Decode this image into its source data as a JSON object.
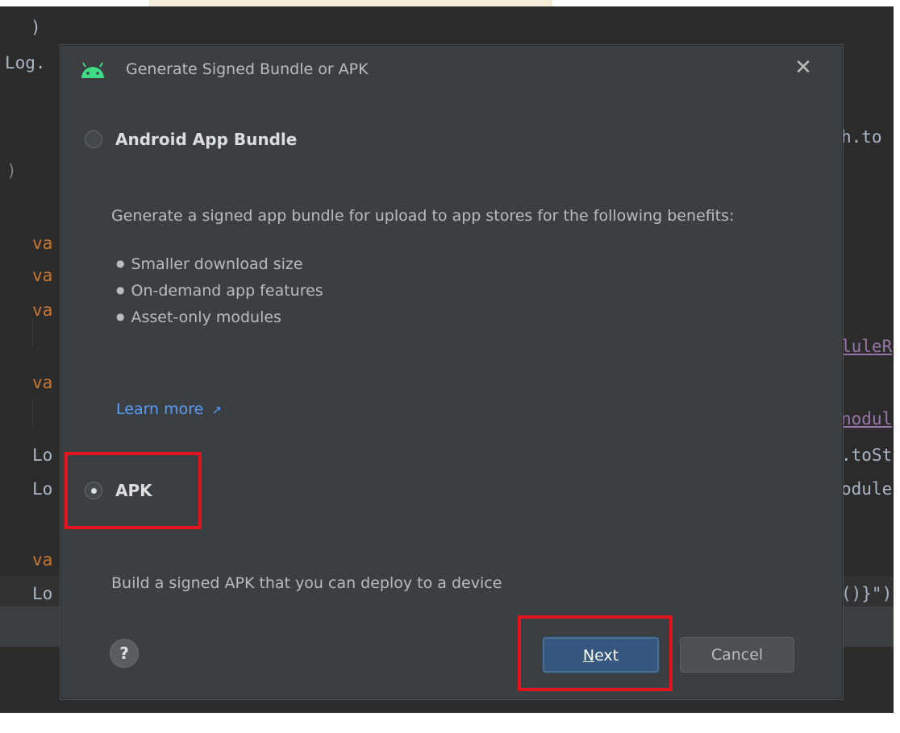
{
  "editor": {
    "lines_left": [
      {
        "text": ")",
        "kind": "plain"
      },
      {
        "text": "Log.",
        "kind": "plain"
      },
      {
        "text": ")",
        "kind": "gray"
      },
      {
        "text": "va",
        "kind": "kw"
      },
      {
        "text": "va",
        "kind": "kw"
      },
      {
        "text": "va",
        "kind": "kw"
      },
      {
        "text": "va",
        "kind": "kw"
      },
      {
        "text": "Lo",
        "kind": "plain"
      },
      {
        "text": "Lo",
        "kind": "plain"
      },
      {
        "text": "va",
        "kind": "kw"
      },
      {
        "text": "Lo",
        "kind": "plain"
      }
    ],
    "lines_right": [
      {
        "text": "h.to",
        "kind": "plain"
      },
      {
        "text": "luleR",
        "kind": "purple"
      },
      {
        "text": "nodul",
        "kind": "purple"
      },
      {
        "text": ".toSt",
        "kind": "plain"
      },
      {
        "text": "odule",
        "kind": "plain"
      },
      {
        "text": "()}\")",
        "kind": "plain"
      }
    ]
  },
  "dialog": {
    "title": "Generate Signed Bundle or APK",
    "close_glyph": "✕",
    "option_bundle": {
      "label": "Android App Bundle",
      "selected": false,
      "description": "Generate a signed app bundle for upload to app stores for the following benefits:",
      "benefits": [
        "Smaller download size",
        "On-demand app features",
        "Asset-only modules"
      ],
      "learn_more": "Learn more",
      "learn_more_arrow": "↗"
    },
    "option_apk": {
      "label": "APK",
      "selected": true,
      "description": "Build a signed APK that you can deploy to a device"
    },
    "help_label": "?",
    "next_mnemonic": "N",
    "next_rest": "ext",
    "cancel_label": "Cancel"
  },
  "colors": {
    "annotation": "#e3141e",
    "link": "#589df6",
    "android_green": "#3ddc84",
    "primary_button": "#365880"
  }
}
